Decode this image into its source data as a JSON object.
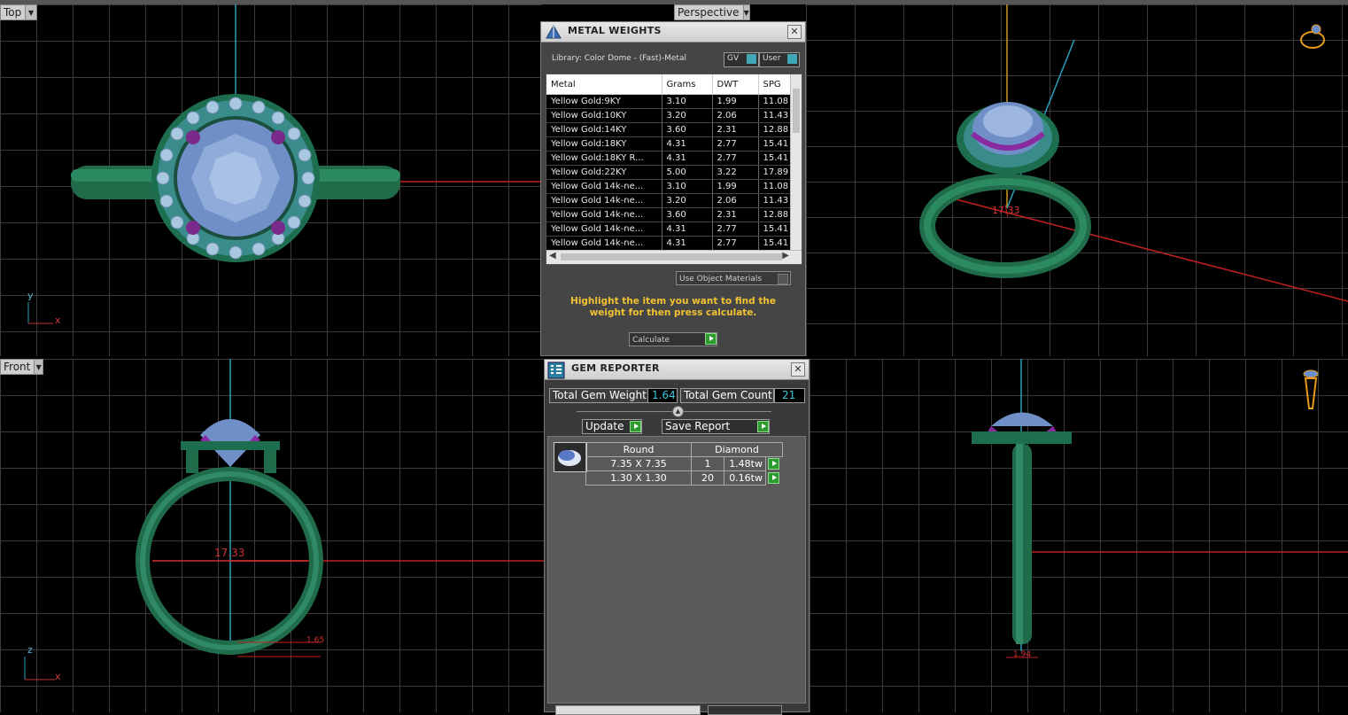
{
  "app": {
    "top_strip_color": "#4a4a4a"
  },
  "viewports": {
    "top": {
      "label": "Top",
      "axis_y": "y",
      "axis_x": "x"
    },
    "perspective": {
      "label": "Perspective",
      "measure": "17.33"
    },
    "front": {
      "label": "Front",
      "measure": "17.33",
      "axis_y": "z",
      "axis_x": "x",
      "small_measure": "1.65"
    },
    "right": {
      "small_measure": "1.94"
    }
  },
  "metal_weights": {
    "title": "METAL WEIGHTS",
    "library": "Library: Color Dome - (Fast)-Metal",
    "gv": "GV",
    "user": "User",
    "columns": [
      "Metal",
      "Grams",
      "DWT",
      "SPG"
    ],
    "rows": [
      [
        "Yellow Gold:9KY",
        "3.10",
        "1.99",
        "11.08"
      ],
      [
        "Yellow Gold:10KY",
        "3.20",
        "2.06",
        "11.43"
      ],
      [
        "Yellow Gold:14KY",
        "3.60",
        "2.31",
        "12.88"
      ],
      [
        "Yellow Gold:18KY",
        "4.31",
        "2.77",
        "15.41"
      ],
      [
        "Yellow Gold:18KY R...",
        "4.31",
        "2.77",
        "15.41"
      ],
      [
        "Yellow Gold:22KY",
        "5.00",
        "3.22",
        "17.89"
      ],
      [
        "Yellow Gold 14k-ne...",
        "3.10",
        "1.99",
        "11.08"
      ],
      [
        "Yellow Gold 14k-ne...",
        "3.20",
        "2.06",
        "11.43"
      ],
      [
        "Yellow Gold 14k-ne...",
        "3.60",
        "2.31",
        "12.88"
      ],
      [
        "Yellow Gold 14k-ne...",
        "4.31",
        "2.77",
        "15.41"
      ],
      [
        "Yellow Gold 14k-ne...",
        "4.31",
        "2.77",
        "15.41"
      ]
    ],
    "use_object_materials": "Use Object Materials",
    "instruction": "Highlight the item you want to find the weight for then press calculate.",
    "calculate": "Calculate"
  },
  "gem_reporter": {
    "title": "GEM REPORTER",
    "total_weight_label": "Total Gem Weight",
    "total_weight_value": "1.64",
    "total_count_label": "Total Gem Count",
    "total_count_value": "21",
    "update": "Update",
    "save_report": "Save Report",
    "shape": "Round",
    "material": "Diamond",
    "gems": [
      {
        "size": "7.35 X 7.35",
        "count": "1",
        "weight": "1.48tw"
      },
      {
        "size": "1.30 X 1.30",
        "count": "20",
        "weight": "0.16tw"
      }
    ]
  }
}
